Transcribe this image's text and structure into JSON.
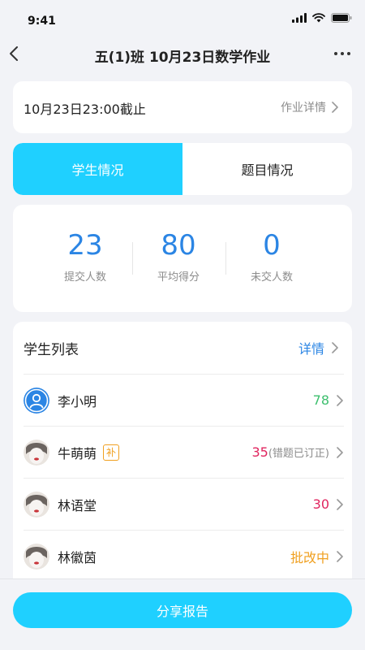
{
  "status_bar": {
    "time": "9:41"
  },
  "nav": {
    "title": "五(1)班  10月23日数学作业"
  },
  "deadline": {
    "text": "10月23日23:00截止",
    "detail_label": "作业详情"
  },
  "tabs": [
    {
      "label": "学生情况",
      "active": true
    },
    {
      "label": "题目情况",
      "active": false
    }
  ],
  "stats": [
    {
      "value": "23",
      "label": "提交人数"
    },
    {
      "value": "80",
      "label": "平均得分"
    },
    {
      "value": "0",
      "label": "未交人数"
    }
  ],
  "student_list": {
    "title": "学生列表",
    "more_label": "详情",
    "rows": [
      {
        "name": "李小明",
        "score": "78",
        "score_color": "#3dbf6e",
        "avatar": "default-user-icon",
        "tag": "",
        "note": ""
      },
      {
        "name": "牛萌萌",
        "score": "35",
        "score_color": "#e0245e",
        "avatar": "student-avatar",
        "tag": "补",
        "note": "(错题已订正)"
      },
      {
        "name": "林语堂",
        "score": "30",
        "score_color": "#e0245e",
        "avatar": "student-avatar",
        "tag": "",
        "note": ""
      },
      {
        "name": "林徽茵",
        "score": "批改中",
        "score_color": "#f0a020",
        "avatar": "student-avatar",
        "tag": "",
        "note": ""
      }
    ]
  },
  "share_button": {
    "label": "分享报告"
  },
  "colors": {
    "accent": "#1fd0ff",
    "stat_blue": "#2b85e4",
    "good": "#3dbf6e",
    "bad": "#e0245e",
    "pending": "#f0a020"
  }
}
